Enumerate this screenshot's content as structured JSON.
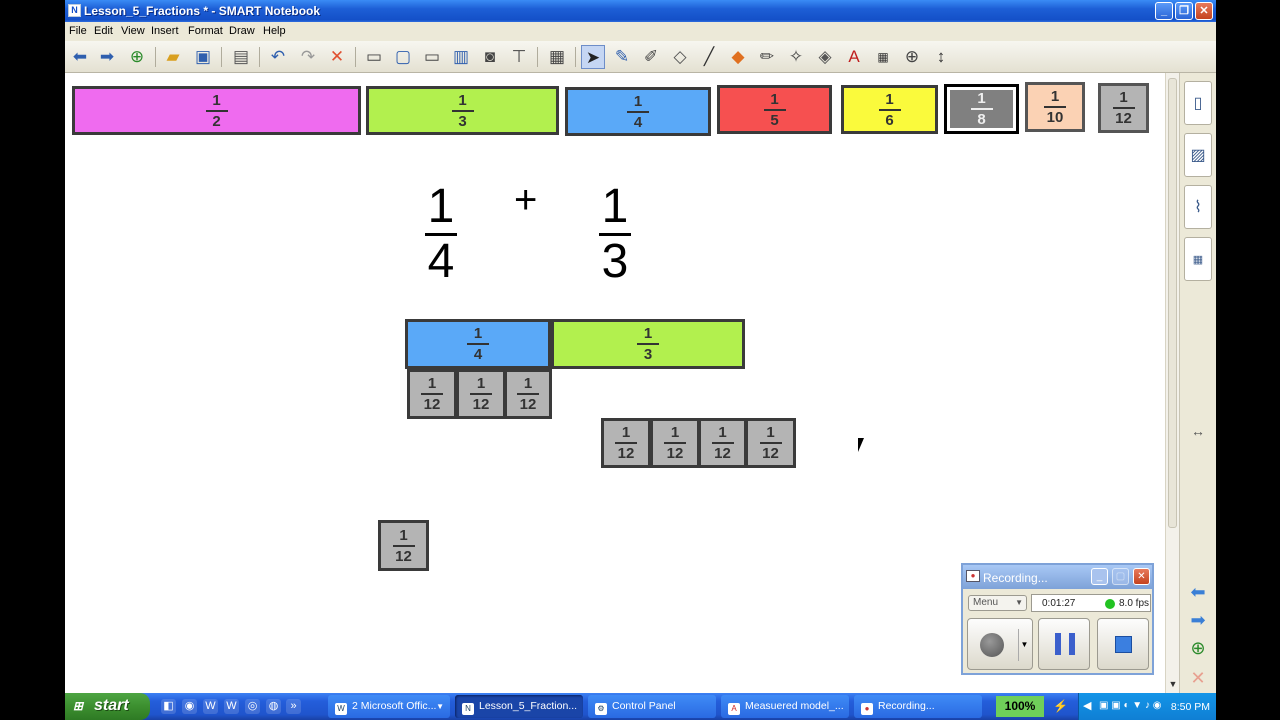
{
  "window": {
    "title": "Lesson_5_Fractions * - SMART Notebook",
    "minimize": "_",
    "maximize": "❐",
    "close": "✕"
  },
  "menu": [
    "File",
    "Edit",
    "View",
    "Insert",
    "Format",
    "Draw",
    "Help"
  ],
  "toolbar": {
    "buttons": [
      "back-arrow",
      "forward-arrow",
      "add-page",
      "open",
      "save",
      "paste",
      "undo",
      "redo",
      "delete",
      "screen-shade",
      "full-screen",
      "transparent-background",
      "dual-page",
      "capture",
      "document-camera",
      "table",
      "select",
      "pen",
      "creative-pen",
      "eraser",
      "line",
      "shapes",
      "magic-pen",
      "fill",
      "text",
      "properties",
      "measurement-tools",
      "more"
    ]
  },
  "fraction_bar_row": [
    {
      "num": "1",
      "den": "2",
      "color": "#ef6bef"
    },
    {
      "num": "1",
      "den": "3",
      "color": "#b2f04e"
    },
    {
      "num": "1",
      "den": "4",
      "color": "#5aa9f8"
    },
    {
      "num": "1",
      "den": "5",
      "color": "#f65050"
    },
    {
      "num": "1",
      "den": "6",
      "color": "#fafa3c"
    },
    {
      "num": "1",
      "den": "8",
      "color": "#a0a0a0"
    },
    {
      "num": "1",
      "den": "10",
      "color": "#fbd2b4"
    },
    {
      "num": "1",
      "den": "12",
      "color": "#b4b4b4"
    }
  ],
  "equation": {
    "left": {
      "num": "1",
      "den": "4"
    },
    "operator": "+",
    "right": {
      "num": "1",
      "den": "3"
    }
  },
  "workspace_tiles": {
    "quarter": {
      "num": "1",
      "den": "4",
      "color": "#5aa9f8"
    },
    "third": {
      "num": "1",
      "den": "3",
      "color": "#b2f04e"
    },
    "twelfth": {
      "num": "1",
      "den": "12",
      "color": "#b4b4b4"
    }
  },
  "recorder": {
    "title": "Recording...",
    "menu_label": "Menu",
    "elapsed": "0:01:27",
    "fps": "8.0 fps",
    "status_color": "#22c322"
  },
  "taskbar": {
    "start": "start",
    "items": [
      "2 Microsoft Offic...",
      "Lesson_5_Fraction...",
      "Control Panel",
      "Measuered model_...",
      "Recording..."
    ],
    "zoom": "100%",
    "clock": "8:50 PM"
  }
}
